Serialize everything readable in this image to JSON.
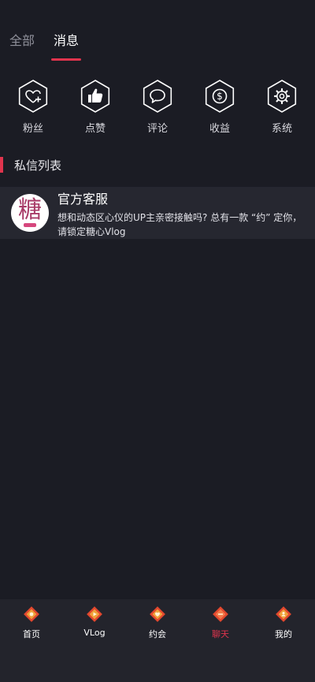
{
  "tabs": [
    {
      "label": "全部",
      "active": false
    },
    {
      "label": "消息",
      "active": true
    }
  ],
  "quick_actions": [
    {
      "label": "粉丝",
      "icon": "heart-plus-icon"
    },
    {
      "label": "点赞",
      "icon": "thumbs-up-icon"
    },
    {
      "label": "评论",
      "icon": "speech-bubble-icon"
    },
    {
      "label": "收益",
      "icon": "dollar-coin-icon"
    },
    {
      "label": "系统",
      "icon": "gear-icon"
    }
  ],
  "section": {
    "title": "私信列表"
  },
  "messages": [
    {
      "name": "官方客服",
      "avatar_char": "糖",
      "preview": "想和动态区心仪的UP主亲密接触吗? 总有一款 “约” 定你，请锁定糖心Vlog"
    }
  ],
  "nav": [
    {
      "label": "首页",
      "active": false
    },
    {
      "label": "VLog",
      "active": false
    },
    {
      "label": "约会",
      "active": false
    },
    {
      "label": "聊天",
      "active": true
    },
    {
      "label": "我的",
      "active": false
    }
  ],
  "colors": {
    "background": "#1b1c24",
    "accent": "#e0344d",
    "row_background": "#262730",
    "nav_background": "#23242c"
  }
}
